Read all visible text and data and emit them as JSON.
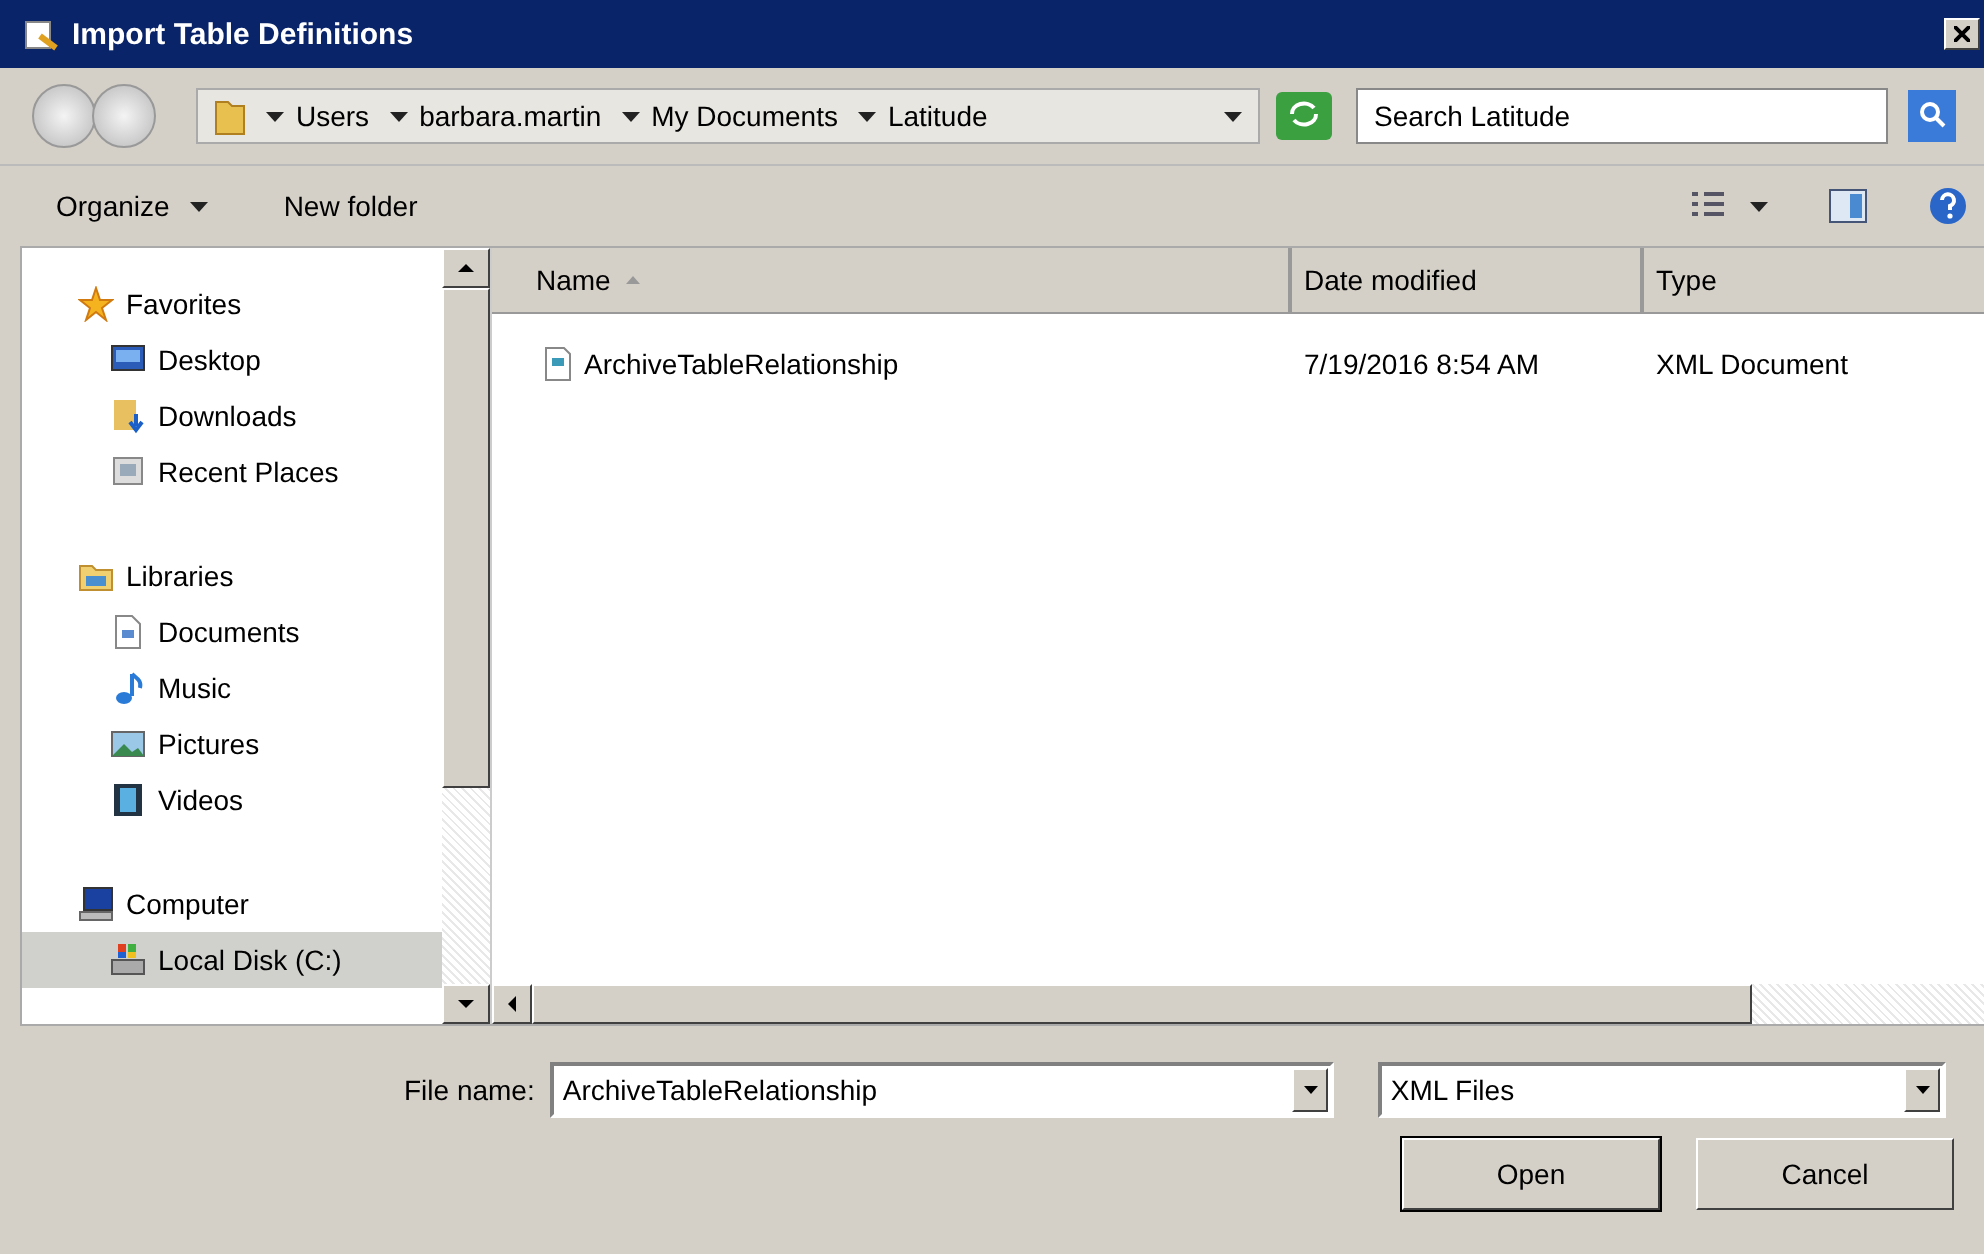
{
  "window": {
    "title": "Import Table Definitions"
  },
  "address_bar": {
    "breadcrumbs": [
      "Users",
      "barbara.martin",
      "My Documents",
      "Latitude"
    ]
  },
  "search": {
    "placeholder": "Search Latitude"
  },
  "toolbar": {
    "buttons": [
      {
        "label": "Organize",
        "dropdown": true
      },
      {
        "label": "New folder",
        "dropdown": false
      }
    ]
  },
  "navigation": [
    {
      "label": "Favorites",
      "selected": false,
      "children": [
        {
          "label": "Desktop",
          "selected": false
        },
        {
          "label": "Downloads",
          "selected": false
        },
        {
          "label": "Recent Places",
          "selected": false
        }
      ]
    },
    {
      "label": "Libraries",
      "selected": false,
      "children": [
        {
          "label": "Documents",
          "selected": false
        },
        {
          "label": "Music",
          "selected": false
        },
        {
          "label": "Pictures",
          "selected": false
        },
        {
          "label": "Videos",
          "selected": false
        }
      ]
    },
    {
      "label": "Computer",
      "selected": false,
      "children": [
        {
          "label": "Local Disk (C:)",
          "selected": true
        }
      ]
    }
  ],
  "file_list": {
    "columns": [
      {
        "label": "Name",
        "sorted": true
      },
      {
        "label": "Date modified",
        "sorted": false
      },
      {
        "label": "Type",
        "sorted": false
      }
    ],
    "rows": [
      {
        "name": "ArchiveTableRelationship",
        "date_modified": "7/19/2016 8:54 AM",
        "type": "XML Document",
        "selected": false
      }
    ]
  },
  "file_name": {
    "label": "File name:",
    "value": "ArchiveTableRelationship"
  },
  "file_type": {
    "value": "XML Files"
  },
  "buttons": [
    {
      "label": "Open",
      "default": true
    },
    {
      "label": "Cancel",
      "default": false
    }
  ]
}
